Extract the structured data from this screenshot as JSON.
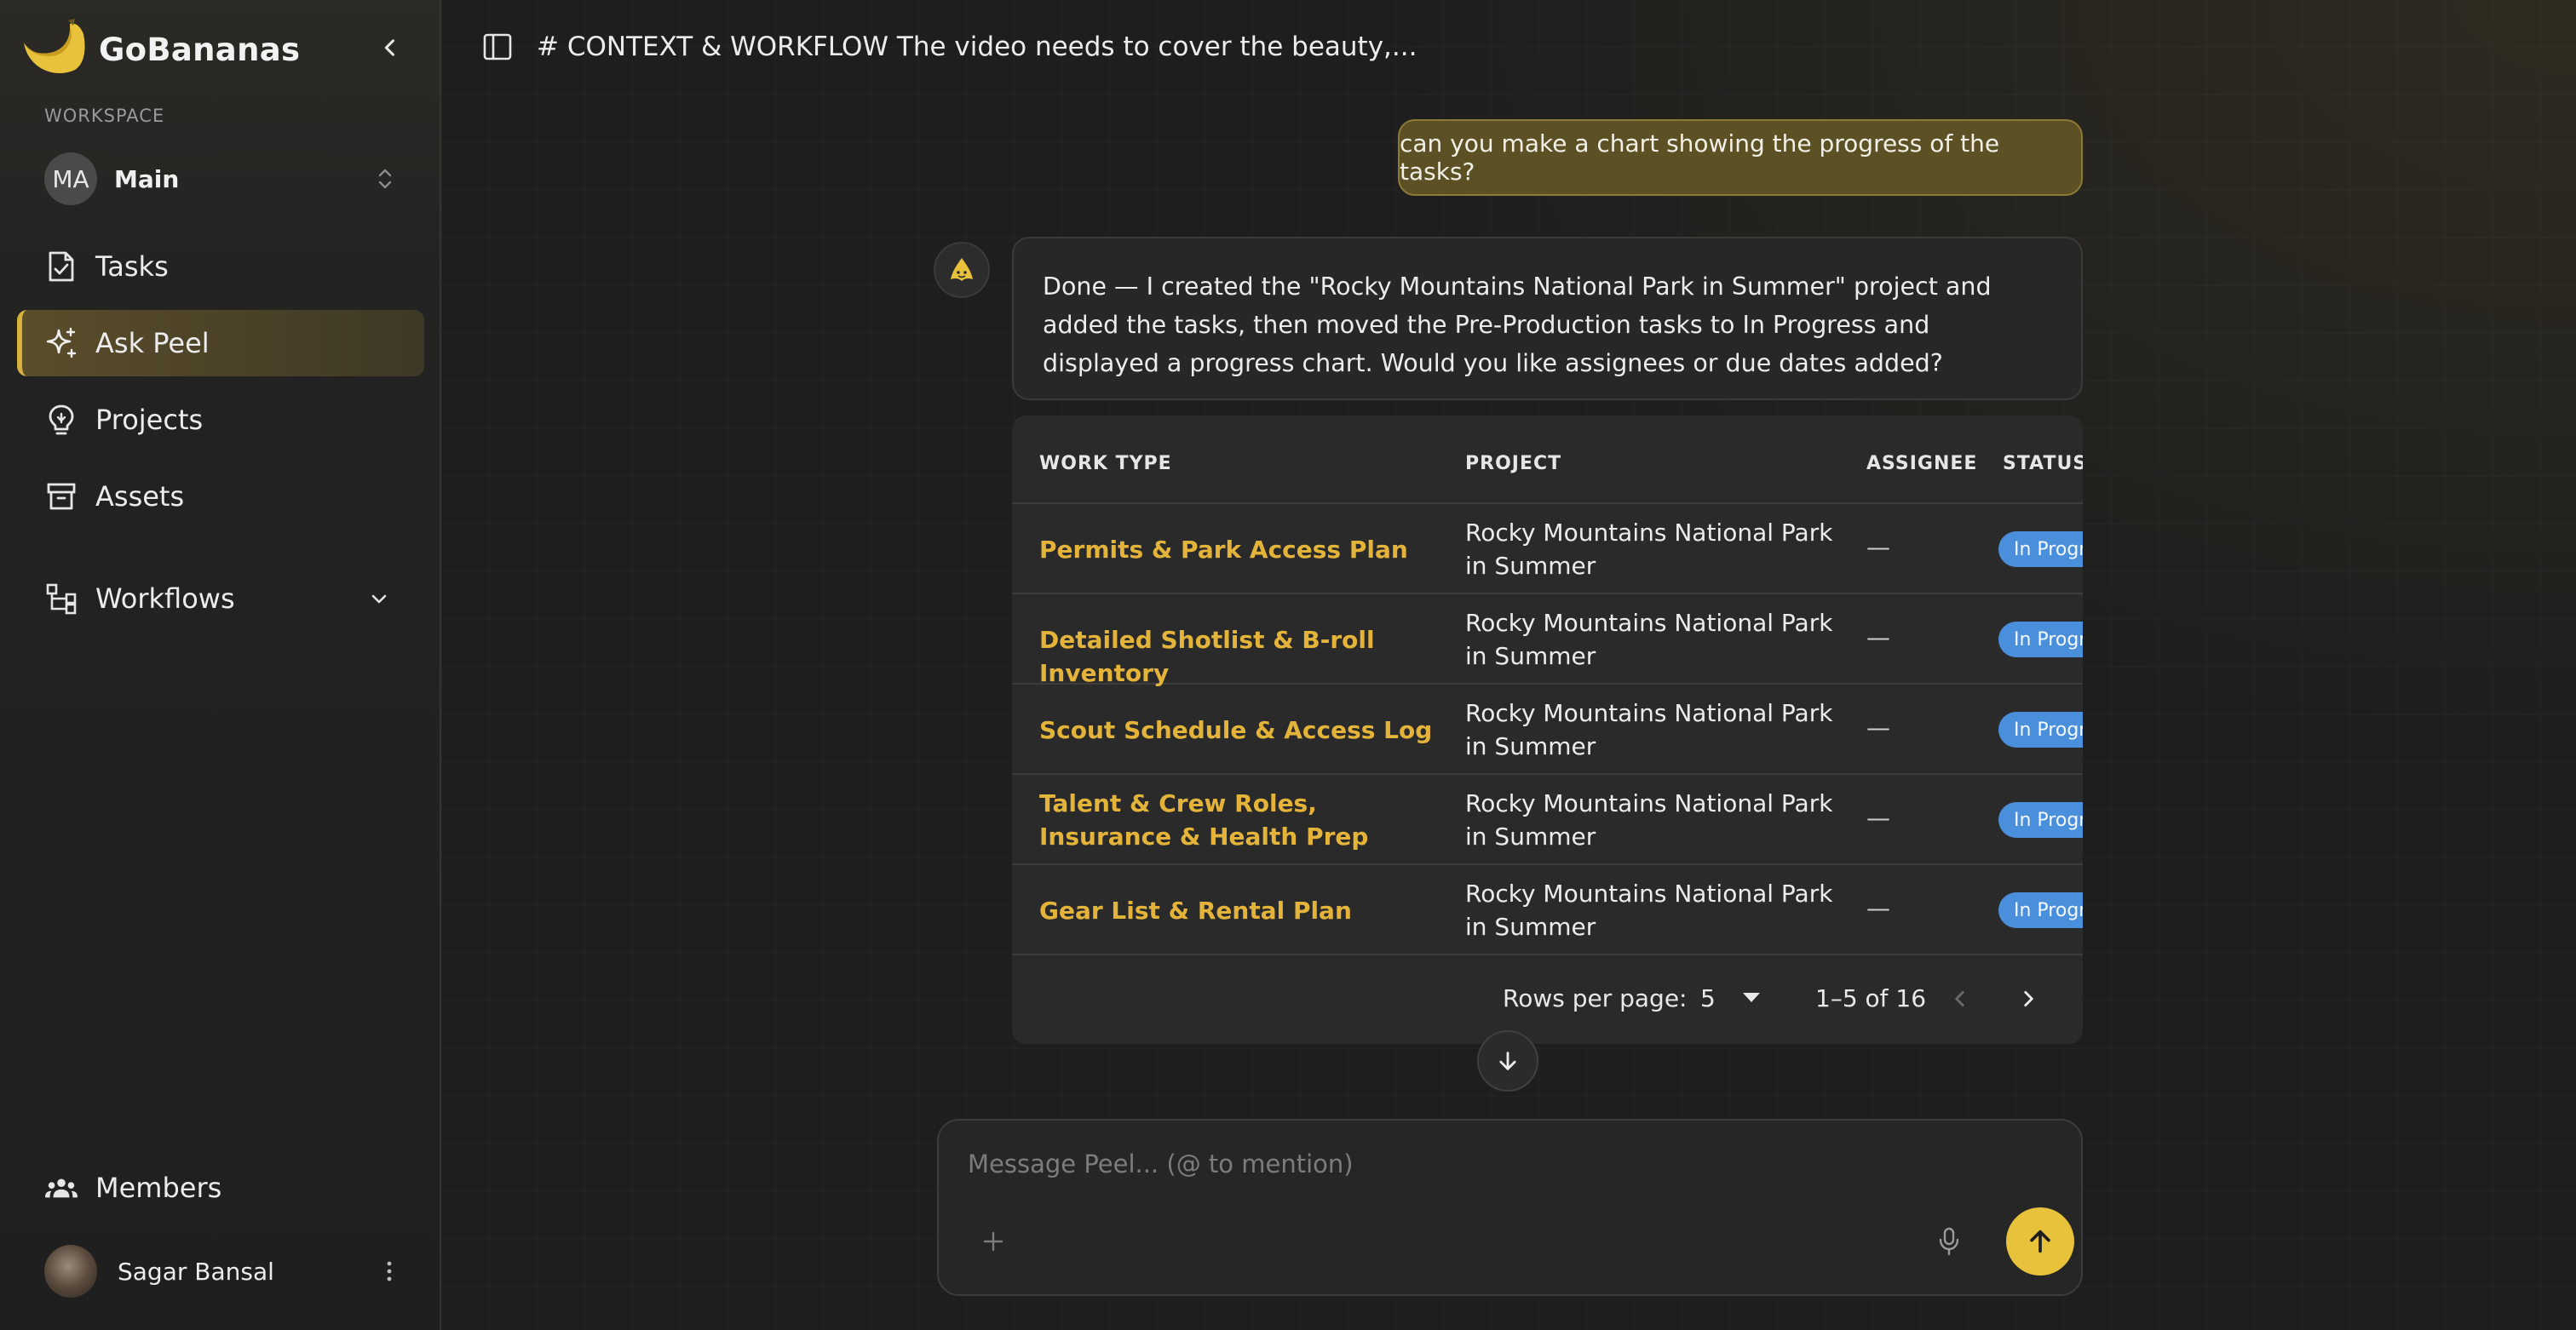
{
  "brand": {
    "name": "GoBananas"
  },
  "workspace": {
    "label": "WORKSPACE",
    "initials": "MA",
    "name": "Main"
  },
  "nav": {
    "tasks": "Tasks",
    "ask_peel": "Ask Peel",
    "projects": "Projects",
    "assets": "Assets",
    "workflows": "Workflows",
    "members": "Members"
  },
  "user": {
    "name": "Sagar Bansal"
  },
  "conversation": {
    "title": "# CONTEXT & WORKFLOW The video needs to cover the beauty,..."
  },
  "messages": {
    "user": "can you make a chart showing the progress of the tasks?",
    "assistant": "Done — I created the \"Rocky Mountains National Park in Summer\" project and added the tasks, then moved the Pre-Production tasks to In Progress and displayed a progress chart. Would you like assignees or due dates added?"
  },
  "table": {
    "headers": {
      "work_type": "WORK TYPE",
      "project": "PROJECT",
      "assignee": "ASSIGNEE",
      "status": "STATUS"
    },
    "rows": [
      {
        "work_type": "Permits & Park Access Plan",
        "project": "Rocky Mountains National Park in Summer",
        "assignee": "—",
        "status": "In Progress"
      },
      {
        "work_type": "Detailed Shotlist & B-roll Inventory",
        "project": "Rocky Mountains National Park in Summer",
        "assignee": "—",
        "status": "In Progress"
      },
      {
        "work_type": "Scout Schedule & Access Log",
        "project": "Rocky Mountains National Park in Summer",
        "assignee": "—",
        "status": "In Progress"
      },
      {
        "work_type": "Talent & Crew Roles, Insurance & Health Prep",
        "project": "Rocky Mountains National Park in Summer",
        "assignee": "—",
        "status": "In Progress"
      },
      {
        "work_type": "Gear List & Rental Plan",
        "project": "Rocky Mountains National Park in Summer",
        "assignee": "—",
        "status": "In Progress"
      }
    ],
    "pagination": {
      "rows_per_page_label": "Rows per page:",
      "rows_per_page": "5",
      "range": "1–5 of 16"
    }
  },
  "composer": {
    "placeholder": "Message Peel... (@ to mention)",
    "value": ""
  },
  "colors": {
    "accent": "#e8c23a",
    "link": "#e4b43a",
    "status_badge": "#4a8fdb",
    "user_bubble": "#5c5125"
  }
}
